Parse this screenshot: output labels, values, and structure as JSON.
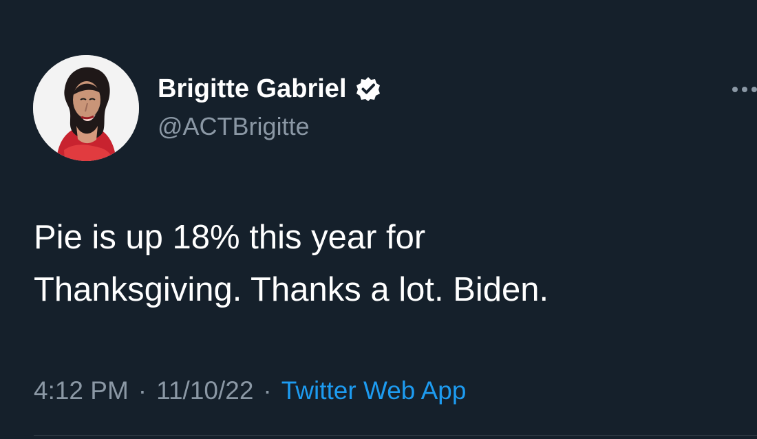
{
  "tweet": {
    "author": {
      "name": "Brigitte Gabriel",
      "handle": "@ACTBrigitte",
      "verified": true
    },
    "text": "Pie is up 18% this year for\nThanksgiving. Thanks a lot. Biden.",
    "time": "4:12 PM",
    "date": "11/10/22",
    "source": "Twitter Web App",
    "separator": "·"
  },
  "icons": {
    "avatar": "profile-photo-icon",
    "verified": "verified-badge-icon",
    "more": "more-horizontal-icon"
  },
  "colors": {
    "background": "#15202b",
    "text": "#ffffff",
    "secondary_text": "#8b98a5",
    "link": "#1d9bf0",
    "divider": "#38444d"
  }
}
